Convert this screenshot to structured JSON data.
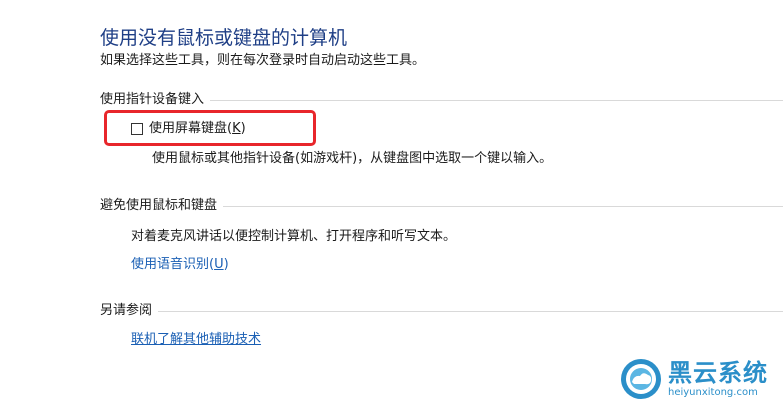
{
  "header": {
    "title": "使用没有鼠标或键盘的计算机",
    "subtitle": "如果选择这些工具，则在每次登录时自动启动这些工具。"
  },
  "section_pointing": {
    "heading": "使用指针设备键入",
    "checkbox": {
      "label_prefix": "使用屏幕键盘(",
      "accel": "K",
      "label_suffix": ")",
      "checked": false
    },
    "description": "使用鼠标或其他指针设备(如游戏杆)，从键盘图中选取一个键以输入。"
  },
  "section_avoid": {
    "heading": "避免使用鼠标和键盘",
    "description": "对着麦克风讲话以便控制计算机、打开程序和听写文本。",
    "link": {
      "prefix": "使用语音识别(",
      "accel": "U",
      "suffix": ")"
    }
  },
  "section_see_also": {
    "heading": "另请参阅",
    "link": "联机了解其他辅助技术"
  },
  "watermark": {
    "name": "黑云系统",
    "url": "heiyunxitong.com"
  },
  "colors": {
    "title": "#1f3f86",
    "link": "#1a5fb4",
    "highlight": "#e8262b",
    "watermark": "#2b8fc9"
  }
}
